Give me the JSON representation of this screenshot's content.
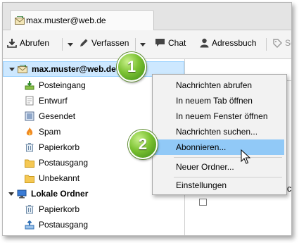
{
  "tab": {
    "title": "max.muster@web.de"
  },
  "toolbar": {
    "abrufen": "Abrufen",
    "verfassen": "Verfassen",
    "chat": "Chat",
    "adressbuch": "Adressbuch",
    "filter_partial": "Sc"
  },
  "folders": {
    "account": "max.muster@web.de",
    "items": [
      "Posteingang",
      "Entwurf",
      "Gesendet",
      "Spam",
      "Papierkorb",
      "Postausgang",
      "Unbekannt"
    ],
    "local": "Lokale Ordner",
    "local_items": [
      "Papierkorb",
      "Postausgang"
    ]
  },
  "context_menu": {
    "items": [
      "Nachrichten abrufen",
      "In neuem Tab öffnen",
      "In neuem Fenster öffnen",
      "Nachrichten suchen...",
      "Abonnieren...",
      "Neuer Ordner...",
      "Einstellungen"
    ],
    "highlighted_index": 4
  },
  "right_pane": {
    "partial_text": "ic"
  },
  "badges": [
    "1",
    "2"
  ],
  "colors": {
    "selection": "#cde8ff",
    "menu_highlight": "#91c9f7",
    "badge_green": "#7cc233"
  }
}
